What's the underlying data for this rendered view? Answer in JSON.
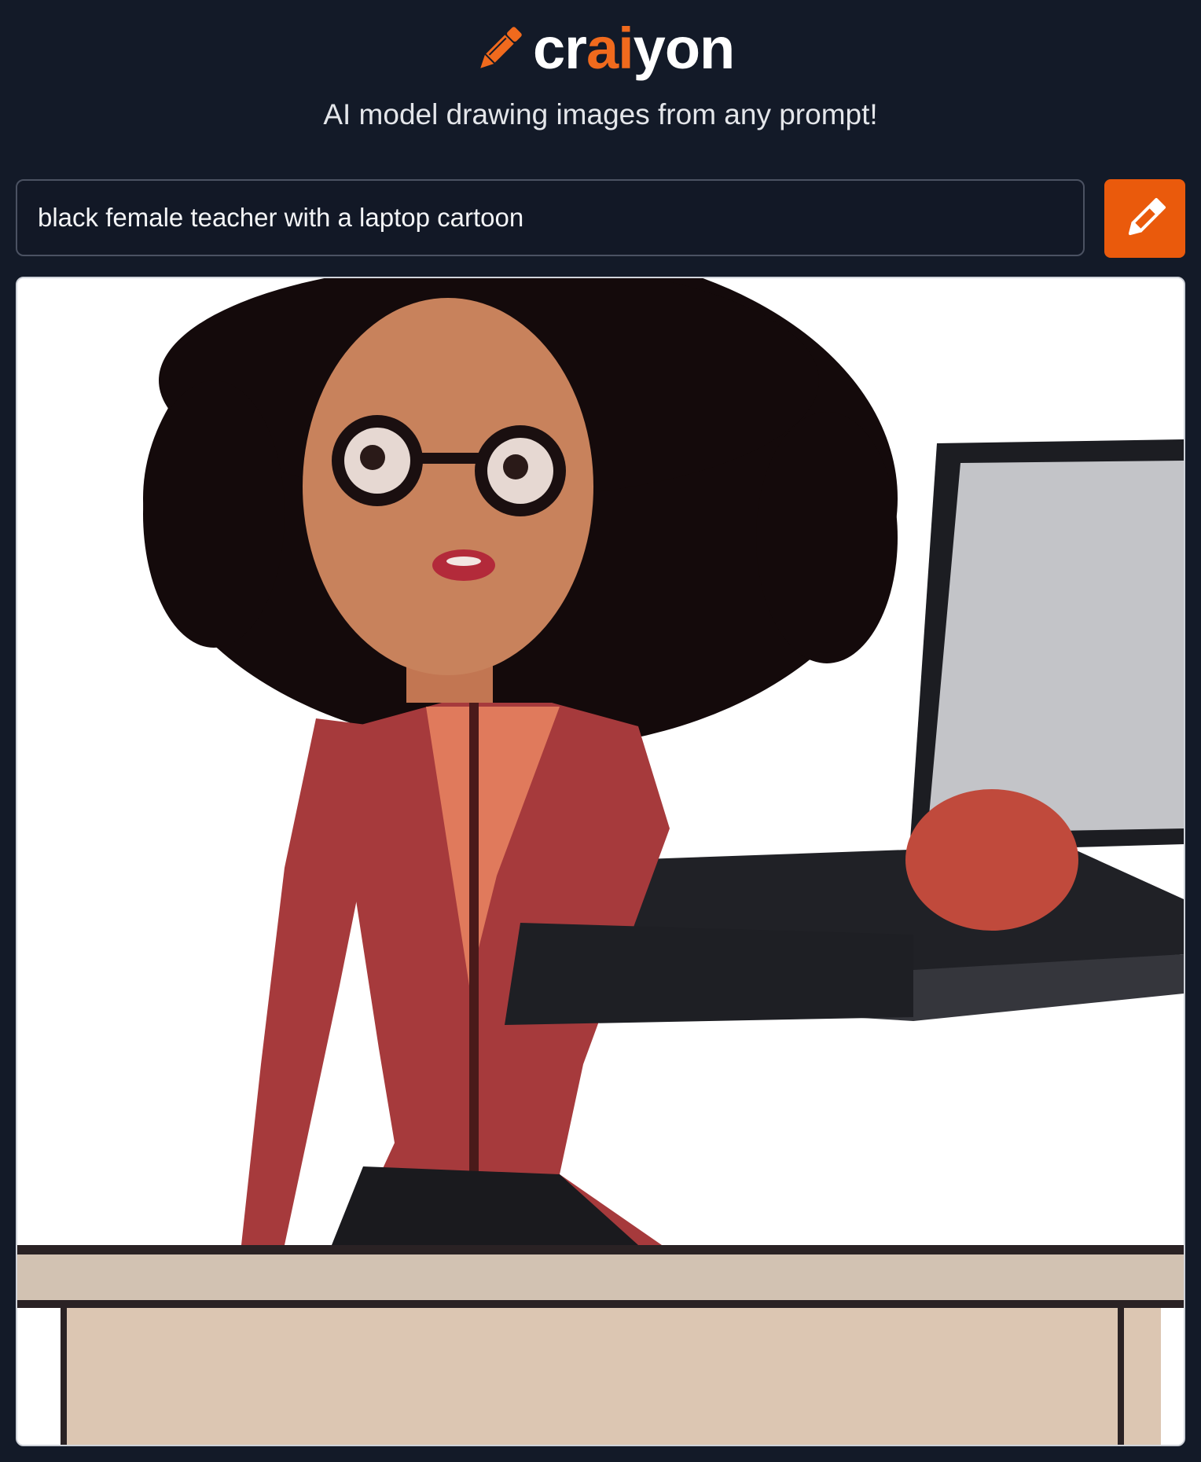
{
  "app": {
    "logo": {
      "prefix": "cr",
      "accent": "ai",
      "suffix": "yon"
    },
    "tagline": "AI model drawing images from any prompt!",
    "accent_color": "#ea5a0c",
    "background_color": "#131a28"
  },
  "prompt": {
    "value": "black female teacher with a laptop cartoon",
    "submit_icon": "pencil-icon"
  },
  "result": {
    "image_subject": "cartoon teacher with glasses and laptop at a desk"
  }
}
